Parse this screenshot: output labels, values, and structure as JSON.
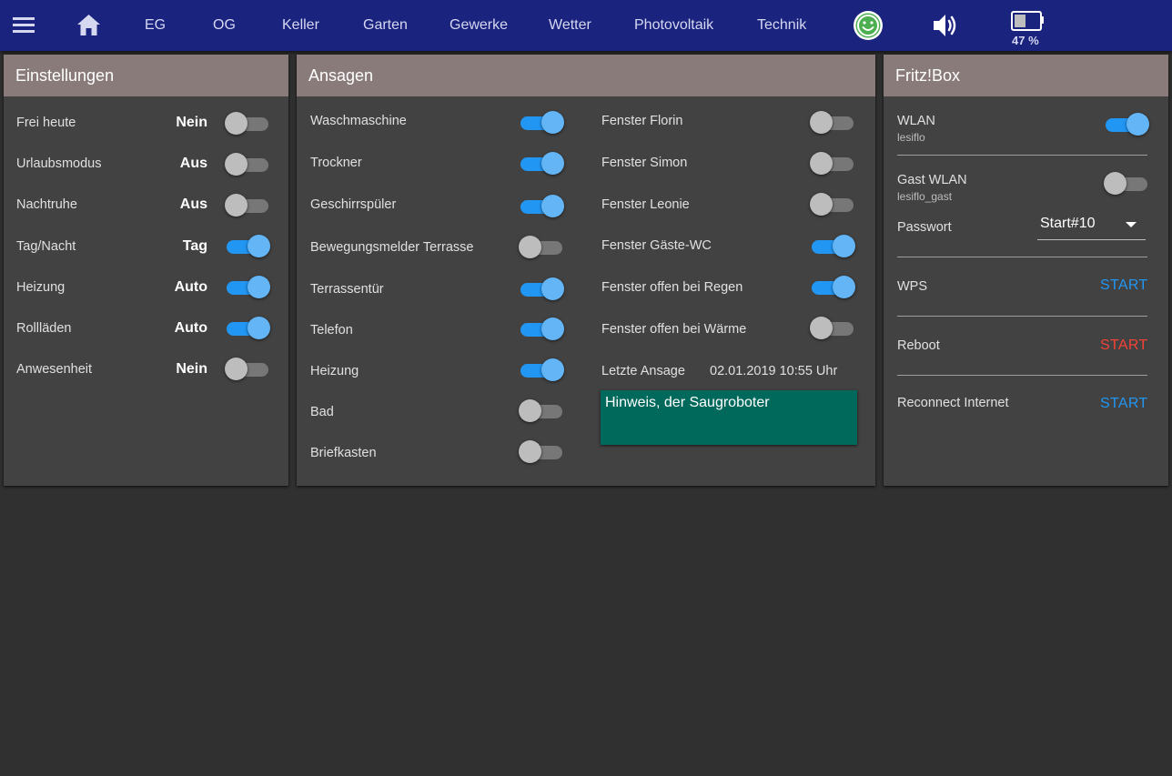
{
  "nav": {
    "items": [
      "EG",
      "OG",
      "Keller",
      "Garten",
      "Gewerke",
      "Wetter",
      "Photovoltaik",
      "Technik"
    ],
    "battery_percent_label": "47 %",
    "battery_level": 0.47,
    "accent_color": "#1a237e"
  },
  "einstellungen": {
    "title": "Einstellungen",
    "rows": [
      {
        "label": "Frei heute",
        "value": "Nein",
        "on": false
      },
      {
        "label": "Urlaubsmodus",
        "value": "Aus",
        "on": false
      },
      {
        "label": "Nachtruhe",
        "value": "Aus",
        "on": false
      },
      {
        "label": "Tag/Nacht",
        "value": "Tag",
        "on": true
      },
      {
        "label": "Heizung",
        "value": "Auto",
        "on": true
      },
      {
        "label": "Rollläden",
        "value": "Auto",
        "on": true
      },
      {
        "label": "Anwesenheit",
        "value": "Nein",
        "on": false
      }
    ]
  },
  "ansagen": {
    "title": "Ansagen",
    "left": [
      {
        "label": "Waschmaschine",
        "on": true
      },
      {
        "label": "Trockner",
        "on": true
      },
      {
        "label": "Geschirrspüler",
        "on": true
      },
      {
        "label": "Bewegungsmelder Terrasse",
        "on": false
      },
      {
        "label": "Terrassentür",
        "on": true
      },
      {
        "label": "Telefon",
        "on": true
      },
      {
        "label": "Heizung",
        "on": true
      },
      {
        "label": "Bad",
        "on": false
      },
      {
        "label": "Briefkasten",
        "on": false
      }
    ],
    "right": [
      {
        "label": "Fenster Florin",
        "on": false
      },
      {
        "label": "Fenster Simon",
        "on": false
      },
      {
        "label": "Fenster Leonie",
        "on": false
      },
      {
        "label": "Fenster Gäste-WC",
        "on": true
      },
      {
        "label": "Fenster offen bei Regen",
        "on": true
      },
      {
        "label": "Fenster offen bei Wärme",
        "on": false
      }
    ],
    "last_label": "Letzte Ansage",
    "last_time": "02.01.2019 10:55 Uhr",
    "hint_text": "Hinweis, der Saugroboter"
  },
  "fritzbox": {
    "title": "Fritz!Box",
    "wlan_label": "WLAN",
    "wlan_sub": "lesiflo",
    "wlan_on": true,
    "gast_label": "Gast WLAN",
    "gast_sub": "lesiflo_gast",
    "gast_on": false,
    "passwort_label": "Passwort",
    "passwort_value": "Start#10",
    "wps_label": "WPS",
    "wps_button": "START",
    "reboot_label": "Reboot",
    "reboot_button": "START",
    "reconnect_label": "Reconnect Internet",
    "reconnect_button": "START"
  }
}
